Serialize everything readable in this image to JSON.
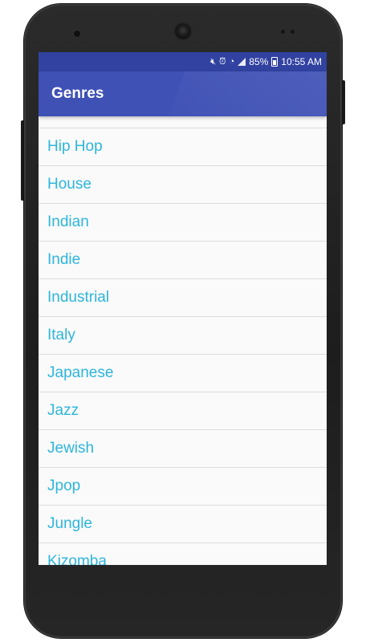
{
  "status_bar": {
    "battery": "85%",
    "time": "10:55 AM"
  },
  "app_bar": {
    "title": "Genres"
  },
  "genres": [
    "Hip Hop",
    "House",
    "Indian",
    "Indie",
    "Industrial",
    "Italy",
    "Japanese",
    "Jazz",
    "Jewish",
    "Jpop",
    "Jungle",
    "Kizomba"
  ],
  "colors": {
    "primary": "#3f51b5",
    "primary_dark": "#3142a0",
    "list_text": "#2db5dc"
  }
}
